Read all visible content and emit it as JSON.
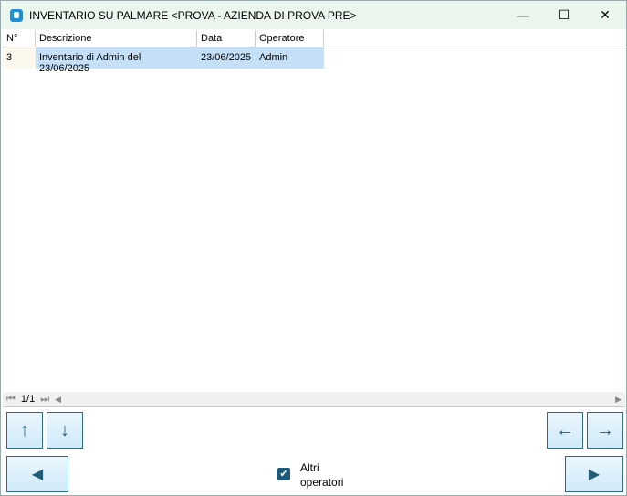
{
  "window": {
    "title": "INVENTARIO SU PALMARE <PROVA - AZIENDA DI PROVA PRE>",
    "minimize": "—",
    "maximize": "☐",
    "close": "✕"
  },
  "table": {
    "columns": [
      "N°",
      "Descrizione",
      "Data",
      "Operatore"
    ],
    "rows": [
      {
        "n": "3",
        "descrizione": "Inventario di Admin del 23/06/2025",
        "data": "23/06/2025",
        "operatore": "Admin"
      }
    ]
  },
  "pager": {
    "first": "⏮",
    "page": "1/1",
    "last": "⏭",
    "scroll_left": "◀",
    "scroll_right": "▶"
  },
  "buttons": {
    "up": "↑",
    "down": "↓",
    "left": "←",
    "right": "→",
    "prev": "◀",
    "next": "▶"
  },
  "checkbox": {
    "label_line1": "Altri",
    "label_line2": "operatori",
    "checked": true,
    "mark": "✔"
  }
}
